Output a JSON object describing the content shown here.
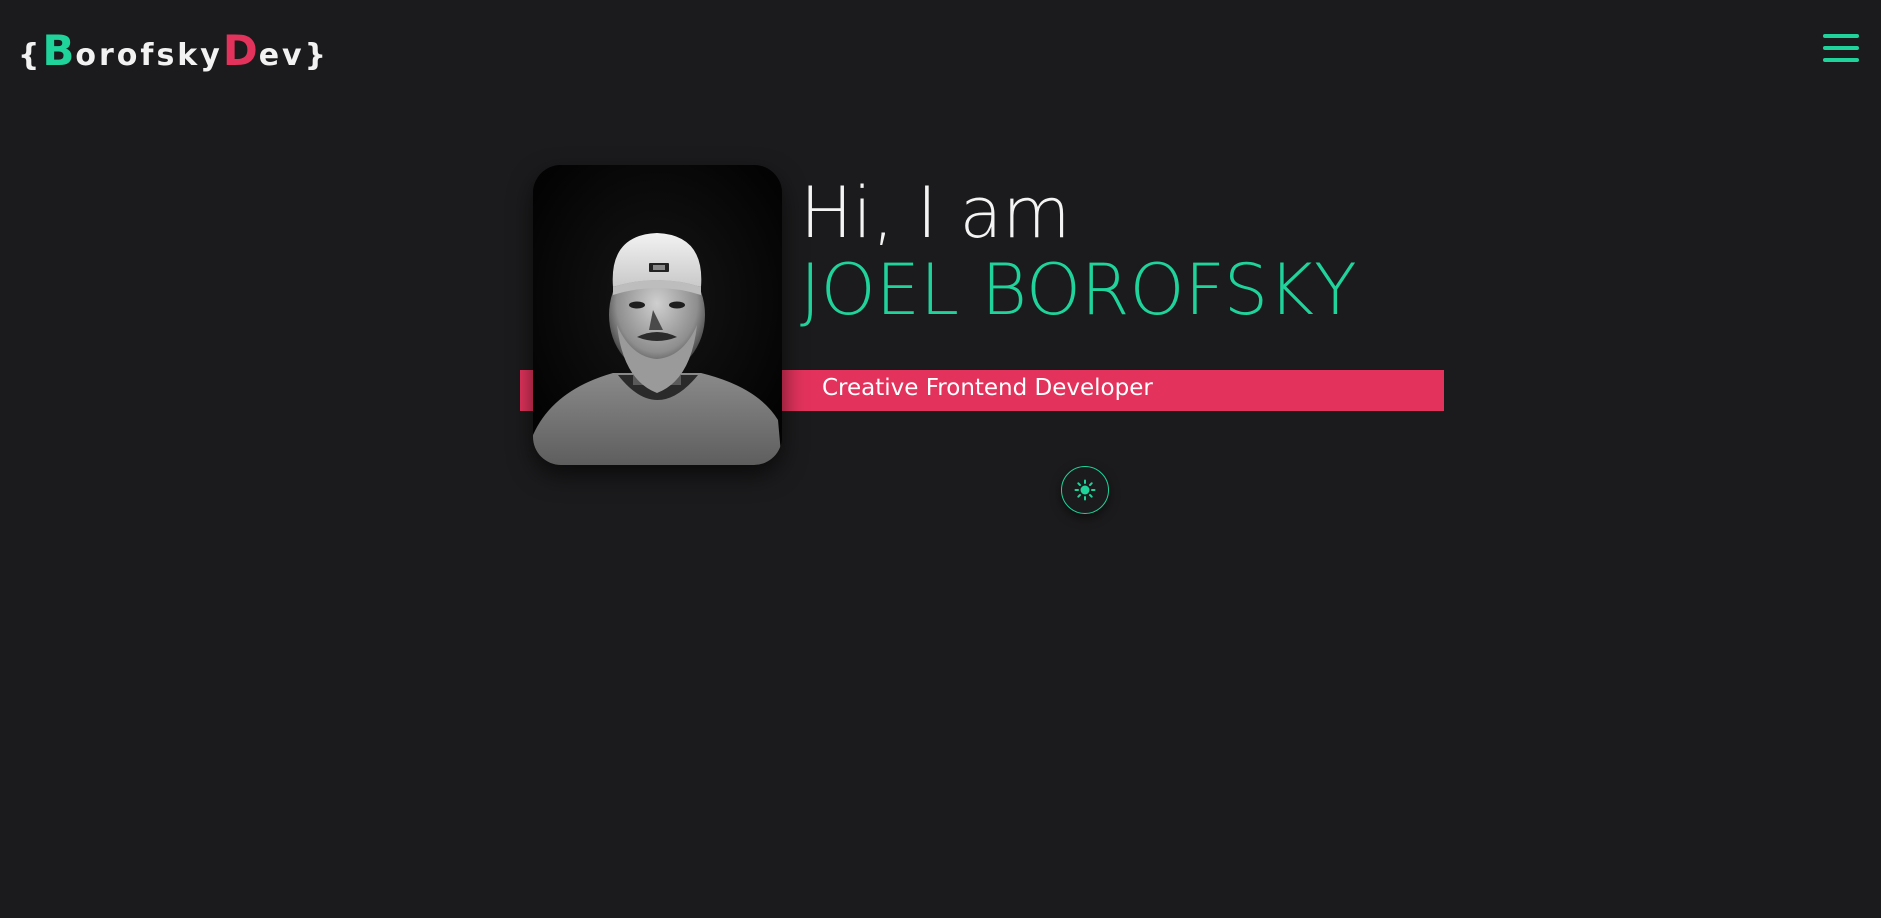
{
  "header": {
    "logo": {
      "open_brace": "{",
      "first_cap": "B",
      "first_rest": "orofsky",
      "second_cap": "D",
      "second_rest": "ev",
      "close_brace": " }"
    },
    "menu_icon": "hamburger-menu-icon"
  },
  "hero": {
    "greeting": "Hi, I am",
    "name": "JOEL BOROFSKY",
    "role": "Creative Frontend Developer",
    "photo_alt": "portrait photo",
    "theme_toggle_icon": "sun-icon"
  },
  "colors": {
    "background": "#1b1b1d",
    "accent_green": "#1fd39a",
    "accent_pink": "#e3335c",
    "text": "#f4f4f4"
  }
}
